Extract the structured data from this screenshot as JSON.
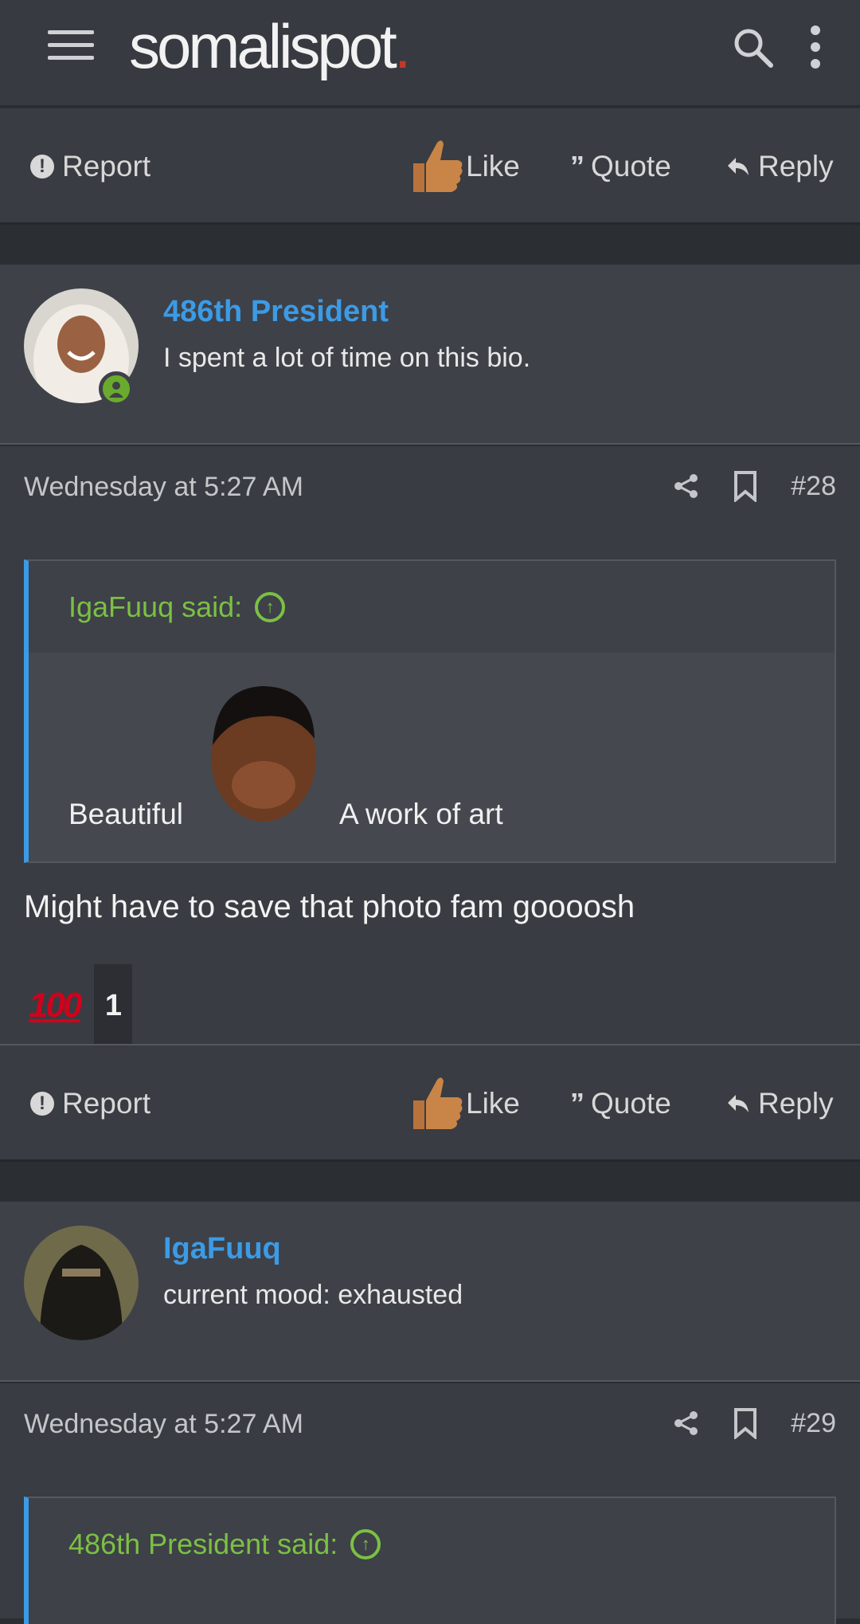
{
  "header": {
    "logo_text": "somalispot",
    "logo_dot": ".",
    "search_icon": "search-icon",
    "menu_icon": "more-vert-icon"
  },
  "actions_top": {
    "report": "Report",
    "like": "Like",
    "quote": "Quote",
    "reply": "Reply"
  },
  "post1": {
    "user": {
      "name": "486th President",
      "bio": "I spent a lot of time on this bio.",
      "online": true
    },
    "timestamp": "Wednesday at 5:27 AM",
    "number": "#28",
    "quote": {
      "author_said": "IgaFuuq said:",
      "text_left": "Beautiful",
      "text_right": "A work of art"
    },
    "body": "Might have to save that photo fam gooоosh",
    "reaction": {
      "emoji": "100",
      "count": "1"
    },
    "actions": {
      "report": "Report",
      "like": "Like",
      "quote": "Quote",
      "reply": "Reply"
    }
  },
  "post2": {
    "user": {
      "name": "IgaFuuq",
      "bio": "current mood: exhausted"
    },
    "timestamp": "Wednesday at 5:27 AM",
    "number": "#29",
    "quote": {
      "author_said": "486th President said:"
    }
  },
  "colors": {
    "accent_blue": "#3b9be6",
    "quote_green": "#7bc043",
    "online_green": "#6aab2e",
    "background": "#393c42"
  }
}
